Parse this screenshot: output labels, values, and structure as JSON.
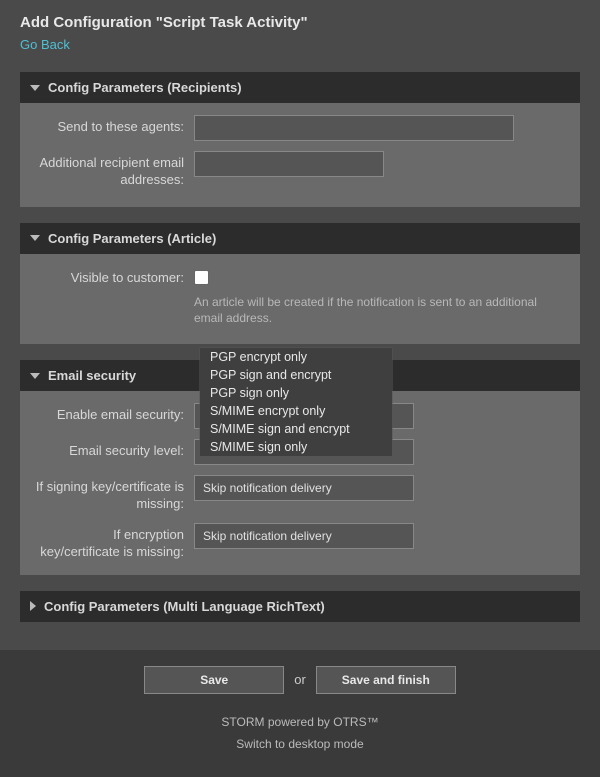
{
  "header": {
    "title": "Add Configuration \"Script Task Activity\"",
    "back": "Go Back"
  },
  "sections": {
    "recipients": {
      "title": "Config Parameters (Recipients)",
      "fields": {
        "send_to_agents": {
          "label": "Send to these agents:",
          "value": ""
        },
        "additional_emails": {
          "label": "Additional recipient email addresses:",
          "value": ""
        }
      }
    },
    "article": {
      "title": "Config Parameters (Article)",
      "fields": {
        "visible": {
          "label": "Visible to customer:",
          "checked": false
        },
        "help": "An article will be created if the notification is sent to an additional email address."
      }
    },
    "email_security": {
      "title": "Email security",
      "fields": {
        "enable": {
          "label": "Enable email security:",
          "value": ""
        },
        "level": {
          "label": "Email security level:",
          "value": ""
        },
        "signing_missing": {
          "label": "If signing key/certificate is missing:",
          "value": "Skip notification delivery"
        },
        "encryption_missing": {
          "label": "If encryption key/certificate is missing:",
          "value": "Skip notification delivery"
        }
      },
      "level_options": [
        "PGP encrypt only",
        "PGP sign and encrypt",
        "PGP sign only",
        "S/MIME encrypt only",
        "S/MIME sign and encrypt",
        "S/MIME sign only"
      ]
    },
    "multi_lang": {
      "title": "Config Parameters (Multi Language RichText)"
    }
  },
  "footer": {
    "save": "Save",
    "or": "or",
    "save_finish": "Save and finish",
    "powered": "STORM powered by OTRS™",
    "switch": "Switch to desktop mode"
  }
}
